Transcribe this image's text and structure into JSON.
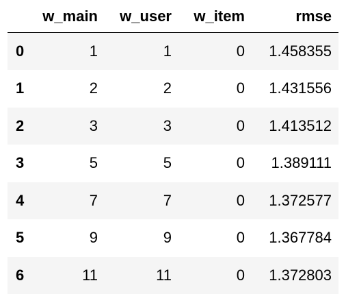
{
  "table": {
    "columns": [
      "",
      "w_main",
      "w_user",
      "w_item",
      "rmse"
    ],
    "rows": [
      {
        "index": "0",
        "w_main": "1",
        "w_user": "1",
        "w_item": "0",
        "rmse": "1.458355"
      },
      {
        "index": "1",
        "w_main": "2",
        "w_user": "2",
        "w_item": "0",
        "rmse": "1.431556"
      },
      {
        "index": "2",
        "w_main": "3",
        "w_user": "3",
        "w_item": "0",
        "rmse": "1.413512"
      },
      {
        "index": "3",
        "w_main": "5",
        "w_user": "5",
        "w_item": "0",
        "rmse": "1.389111"
      },
      {
        "index": "4",
        "w_main": "7",
        "w_user": "7",
        "w_item": "0",
        "rmse": "1.372577"
      },
      {
        "index": "5",
        "w_main": "9",
        "w_user": "9",
        "w_item": "0",
        "rmse": "1.367784"
      },
      {
        "index": "6",
        "w_main": "11",
        "w_user": "11",
        "w_item": "0",
        "rmse": "1.372803"
      }
    ]
  },
  "colors": {
    "stripe": "#f5f5f5",
    "text": "#000000",
    "header_rule": "#000000"
  }
}
